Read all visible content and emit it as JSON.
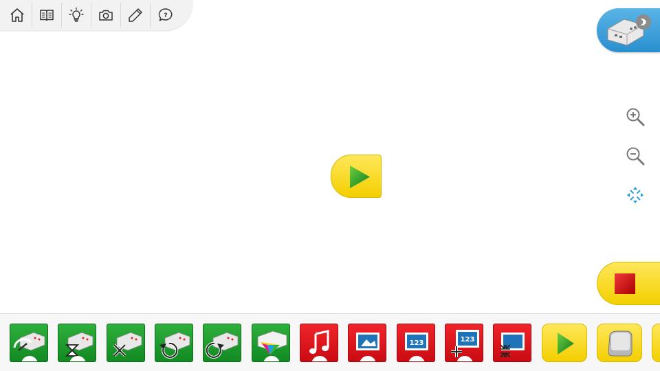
{
  "toolbar": {
    "items": [
      {
        "name": "home-icon"
      },
      {
        "name": "book-icon"
      },
      {
        "name": "lightbulb-icon"
      },
      {
        "name": "camera-icon"
      },
      {
        "name": "pencil-icon"
      },
      {
        "name": "help-bubble-icon",
        "label": "?"
      }
    ]
  },
  "hub": {
    "icon": "smarthub-icon",
    "status_icon": "bluetooth-icon"
  },
  "zoom": {
    "items": [
      "zoom-in-icon",
      "zoom-out-icon",
      "fit-to-screen-icon"
    ]
  },
  "canvas": {
    "start_block_icon": "play-icon"
  },
  "stop": {
    "icon": "stop-square-icon"
  },
  "palette": {
    "blocks": [
      {
        "name": "motor-power-block",
        "color": "green"
      },
      {
        "name": "motor-on-for-time-block",
        "color": "green"
      },
      {
        "name": "motor-off-block",
        "color": "green"
      },
      {
        "name": "motor-counterclockwise-block",
        "color": "green"
      },
      {
        "name": "motor-clockwise-block",
        "color": "green"
      },
      {
        "name": "hub-light-color-block",
        "color": "green"
      },
      {
        "name": "play-sound-block",
        "color": "red"
      },
      {
        "name": "display-image-block",
        "color": "red"
      },
      {
        "name": "display-number-block",
        "color": "red",
        "label": "123"
      },
      {
        "name": "add-to-display-block",
        "color": "red",
        "label": "123"
      },
      {
        "name": "shrink-display-block",
        "color": "red"
      },
      {
        "name": "start-block",
        "color": "yellow"
      },
      {
        "name": "start-on-key-block",
        "color": "yellow"
      }
    ]
  },
  "colors": {
    "green": "#1e9a2e",
    "red": "#e0161c",
    "yellow": "#f7d81a",
    "blue": "#2a8fcf"
  }
}
